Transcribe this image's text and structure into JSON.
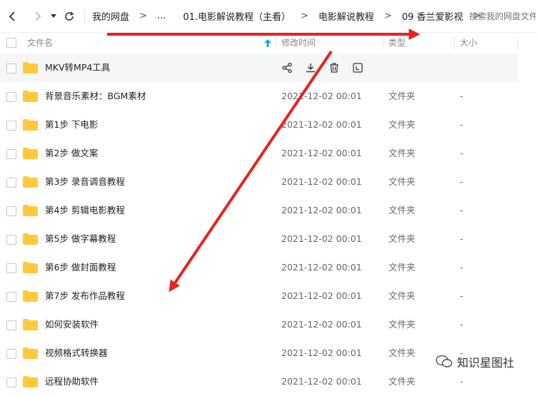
{
  "toolbar": {
    "breadcrumbs": [
      "我的网盘",
      "...",
      "01.电影解说教程（主看）",
      "电影解说教程",
      "09 香兰爱影视"
    ],
    "search_placeholder": "搜索我的网盘文件"
  },
  "columns": {
    "name": "文件名",
    "modified": "修改时间",
    "type": "类型",
    "size": "大小"
  },
  "rows": [
    {
      "name": "MKV转MP4工具",
      "date": "",
      "type": "",
      "size": ""
    },
    {
      "name": "背景音乐素材：BGM素材",
      "date": "2021-12-02 00:01",
      "type": "文件夹",
      "size": "-"
    },
    {
      "name": "第1步 下电影",
      "date": "2021-12-02 00:01",
      "type": "文件夹",
      "size": "-"
    },
    {
      "name": "第2步 做文案",
      "date": "2021-12-02 00:01",
      "type": "文件夹",
      "size": "-"
    },
    {
      "name": "第3步 录音调音教程",
      "date": "2021-12-02 00:01",
      "type": "文件夹",
      "size": "-"
    },
    {
      "name": "第4步 剪辑电影教程",
      "date": "2021-12-02 00:01",
      "type": "文件夹",
      "size": "-"
    },
    {
      "name": "第5步 做字幕教程",
      "date": "2021-12-02 00:01",
      "type": "文件夹",
      "size": "-"
    },
    {
      "name": "第6步 做封面教程",
      "date": "2021-12-02 00:01",
      "type": "文件夹",
      "size": "-"
    },
    {
      "name": "第7步 发布作品教程",
      "date": "2021-12-02 00:01",
      "type": "文件夹",
      "size": "-"
    },
    {
      "name": "如何安装软件",
      "date": "2021-12-02 00:01",
      "type": "文件夹",
      "size": "-"
    },
    {
      "name": "视频格式转换器",
      "date": "2021-12-02 00:01",
      "type": "文件夹",
      "size": "-"
    },
    {
      "name": "远程协助软件",
      "date": "2021-12-02 00:01",
      "type": "文件夹",
      "size": "-"
    }
  ],
  "icons": {
    "back": "chevron-left-icon",
    "forward": "chevron-right-icon",
    "history": "caret-down-icon",
    "refresh": "refresh-icon",
    "sort": "sort-up-arrow-icon",
    "folder": "folder-icon",
    "share": "share-icon",
    "download": "download-icon",
    "delete": "trash-icon",
    "more": "more-icon"
  },
  "colors": {
    "folder": "#FFC93C",
    "accent": "#06A7FF",
    "arrow": "#E8231F",
    "hover_row": "#F5F6F8"
  },
  "watermark": {
    "text": "知识星图社"
  }
}
